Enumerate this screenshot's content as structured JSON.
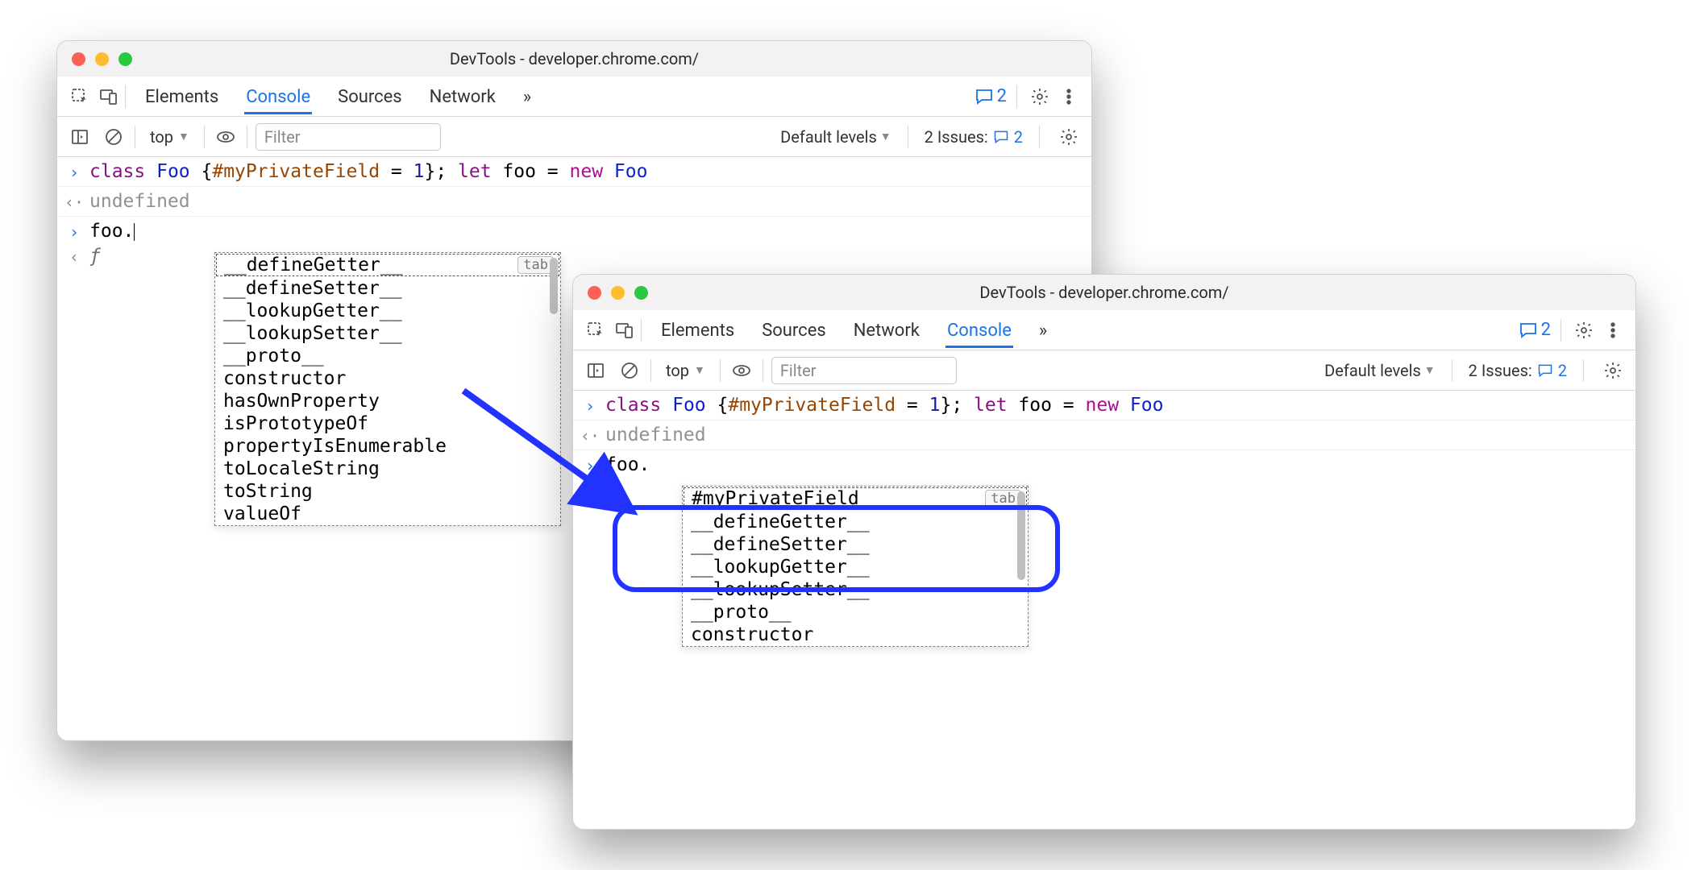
{
  "arrow": {
    "color": "#2232ff"
  },
  "leftWindow": {
    "title": "DevTools - developer.chrome.com/",
    "tabs": [
      "Elements",
      "Console",
      "Sources",
      "Network"
    ],
    "activeTab": "Console",
    "moreTabs": "»",
    "feedbackCount": "2",
    "toolbar": {
      "context": "top",
      "filterPlaceholder": "Filter",
      "levels": "Default levels",
      "issuesLabel": "2 Issues:",
      "issuesCount": "2"
    },
    "console": {
      "inputLine": {
        "tokens": [
          {
            "t": "class ",
            "c": "kw-purple"
          },
          {
            "t": "Foo ",
            "c": "kw-blue"
          },
          {
            "t": "{",
            "c": ""
          },
          {
            "t": "#myPrivateField",
            "c": "kw-prop"
          },
          {
            "t": " = ",
            "c": ""
          },
          {
            "t": "1",
            "c": "kw-num"
          },
          {
            "t": "}; ",
            "c": ""
          },
          {
            "t": "let ",
            "c": "kw-purple"
          },
          {
            "t": "foo = ",
            "c": ""
          },
          {
            "t": "new ",
            "c": "kw-red"
          },
          {
            "t": "Foo",
            "c": "kw-blue"
          }
        ]
      },
      "result": "undefined",
      "prompt": "foo.",
      "fnGlyph": "ƒ",
      "autocomplete": {
        "items": [
          "__defineGetter__",
          "__defineSetter__",
          "__lookupGetter__",
          "__lookupSetter__",
          "__proto__",
          "constructor",
          "hasOwnProperty",
          "isPrototypeOf",
          "propertyIsEnumerable",
          "toLocaleString",
          "toString",
          "valueOf"
        ],
        "selectedIndex": 0,
        "tabHint": "tab"
      }
    }
  },
  "rightWindow": {
    "title": "DevTools - developer.chrome.com/",
    "tabs": [
      "Elements",
      "Sources",
      "Network",
      "Console"
    ],
    "activeTab": "Console",
    "moreTabs": "»",
    "feedbackCount": "2",
    "toolbar": {
      "context": "top",
      "filterPlaceholder": "Filter",
      "levels": "Default levels",
      "issuesLabel": "2 Issues:",
      "issuesCount": "2"
    },
    "console": {
      "inputLine": {
        "tokens": [
          {
            "t": "class ",
            "c": "kw-purple"
          },
          {
            "t": "Foo ",
            "c": "kw-blue"
          },
          {
            "t": "{",
            "c": ""
          },
          {
            "t": "#myPrivateField",
            "c": "kw-prop"
          },
          {
            "t": " = ",
            "c": ""
          },
          {
            "t": "1",
            "c": "kw-num"
          },
          {
            "t": "}; ",
            "c": ""
          },
          {
            "t": "let ",
            "c": "kw-purple"
          },
          {
            "t": "foo = ",
            "c": ""
          },
          {
            "t": "new ",
            "c": "kw-red"
          },
          {
            "t": "Foo",
            "c": "kw-blue"
          }
        ]
      },
      "result": "undefined",
      "prompt": "foo.",
      "autocomplete": {
        "items": [
          "#myPrivateField",
          "__defineGetter__",
          "__defineSetter__",
          "__lookupGetter__",
          "__lookupSetter__",
          "__proto__",
          "constructor"
        ],
        "selectedIndex": 0,
        "tabHint": "tab"
      }
    }
  }
}
